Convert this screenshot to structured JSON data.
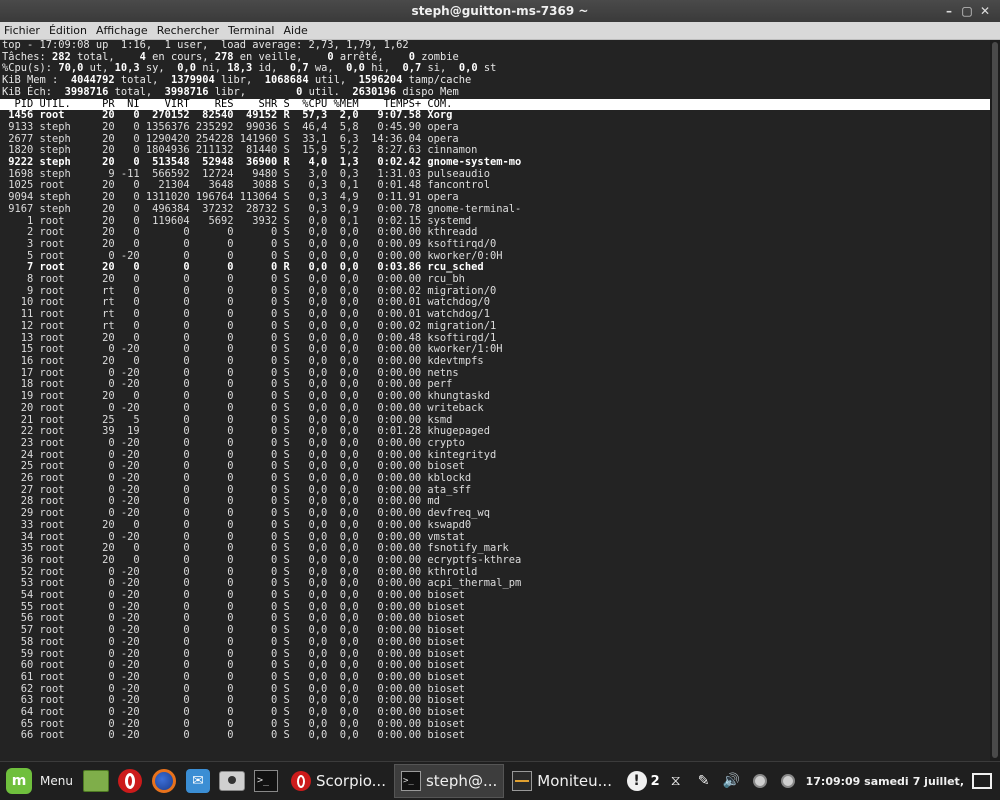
{
  "window": {
    "title": "steph@guitton-ms-7369 ~",
    "controls": [
      "–",
      "▢",
      "✕"
    ]
  },
  "menubar": [
    "Fichier",
    "Édition",
    "Affichage",
    "Rechercher",
    "Terminal",
    "Aide"
  ],
  "top_header": {
    "line1": "top - 17:09:08 up  1:16,  1 user,  load average: 2,73, 1,79, 1,62",
    "line2_parts": [
      "Tâches: ",
      "282",
      " total,    ",
      "4",
      " en cours, ",
      "278",
      " en veille,    ",
      "0",
      " arrêté,    ",
      "0",
      " zombie"
    ],
    "line3_parts": [
      "%Cpu(s): ",
      "70,0",
      " ut, ",
      "10,3",
      " sy,  ",
      "0,0",
      " ni, ",
      "18,3",
      " id,  ",
      "0,7",
      " wa,  ",
      "0,0",
      " hi,  ",
      "0,7",
      " si,  ",
      "0,0",
      " st"
    ],
    "line4_parts": [
      "KiB Mem :  ",
      "4044792",
      " total,  ",
      "1379904",
      " libr,  ",
      "1068684",
      " util,  ",
      "1596204",
      " tamp/cache"
    ],
    "line5_parts": [
      "KiB Éch:  ",
      "3998716",
      " total,  ",
      "3998716",
      " libr,        ",
      "0",
      " util.  ",
      "2630196",
      " dispo Mem"
    ]
  },
  "columns": [
    "PID",
    "UTIL.",
    "PR",
    "NI",
    "VIRT",
    "RES",
    "SHR",
    "S",
    "%CPU",
    "%MEM",
    "TEMPS+",
    "COM."
  ],
  "processes": [
    {
      "pid": "1456",
      "user": "root",
      "pr": "20",
      "ni": "0",
      "virt": "270152",
      "res": "82540",
      "shr": "49152",
      "s": "R",
      "cpu": "57,3",
      "mem": "2,0",
      "time": "9:07.58",
      "cmd": "Xorg",
      "bold": true
    },
    {
      "pid": "9133",
      "user": "steph",
      "pr": "20",
      "ni": "0",
      "virt": "1356376",
      "res": "235292",
      "shr": "99036",
      "s": "S",
      "cpu": "46,4",
      "mem": "5,8",
      "time": "0:45.90",
      "cmd": "opera",
      "bold": false
    },
    {
      "pid": "2677",
      "user": "steph",
      "pr": "20",
      "ni": "0",
      "virt": "1290420",
      "res": "254228",
      "shr": "141960",
      "s": "S",
      "cpu": "33,1",
      "mem": "6,3",
      "time": "14:36.04",
      "cmd": "opera",
      "bold": false
    },
    {
      "pid": "1820",
      "user": "steph",
      "pr": "20",
      "ni": "0",
      "virt": "1804936",
      "res": "211132",
      "shr": "81440",
      "s": "S",
      "cpu": "15,9",
      "mem": "5,2",
      "time": "8:27.63",
      "cmd": "cinnamon",
      "bold": false
    },
    {
      "pid": "9222",
      "user": "steph",
      "pr": "20",
      "ni": "0",
      "virt": "513548",
      "res": "52948",
      "shr": "36900",
      "s": "R",
      "cpu": "4,0",
      "mem": "1,3",
      "time": "0:02.42",
      "cmd": "gnome-system-mo",
      "bold": true
    },
    {
      "pid": "1698",
      "user": "steph",
      "pr": "9",
      "ni": "-11",
      "virt": "566592",
      "res": "12724",
      "shr": "9480",
      "s": "S",
      "cpu": "3,0",
      "mem": "0,3",
      "time": "1:31.03",
      "cmd": "pulseaudio",
      "bold": false
    },
    {
      "pid": "1025",
      "user": "root",
      "pr": "20",
      "ni": "0",
      "virt": "21304",
      "res": "3648",
      "shr": "3088",
      "s": "S",
      "cpu": "0,3",
      "mem": "0,1",
      "time": "0:01.48",
      "cmd": "fancontrol",
      "bold": false
    },
    {
      "pid": "9094",
      "user": "steph",
      "pr": "20",
      "ni": "0",
      "virt": "1311020",
      "res": "196764",
      "shr": "113064",
      "s": "S",
      "cpu": "0,3",
      "mem": "4,9",
      "time": "0:11.91",
      "cmd": "opera",
      "bold": false
    },
    {
      "pid": "9167",
      "user": "steph",
      "pr": "20",
      "ni": "0",
      "virt": "496384",
      "res": "37232",
      "shr": "28732",
      "s": "S",
      "cpu": "0,3",
      "mem": "0,9",
      "time": "0:00.78",
      "cmd": "gnome-terminal-",
      "bold": false
    },
    {
      "pid": "1",
      "user": "root",
      "pr": "20",
      "ni": "0",
      "virt": "119604",
      "res": "5692",
      "shr": "3932",
      "s": "S",
      "cpu": "0,0",
      "mem": "0,1",
      "time": "0:02.15",
      "cmd": "systemd",
      "bold": false
    },
    {
      "pid": "2",
      "user": "root",
      "pr": "20",
      "ni": "0",
      "virt": "0",
      "res": "0",
      "shr": "0",
      "s": "S",
      "cpu": "0,0",
      "mem": "0,0",
      "time": "0:00.00",
      "cmd": "kthreadd",
      "bold": false
    },
    {
      "pid": "3",
      "user": "root",
      "pr": "20",
      "ni": "0",
      "virt": "0",
      "res": "0",
      "shr": "0",
      "s": "S",
      "cpu": "0,0",
      "mem": "0,0",
      "time": "0:00.09",
      "cmd": "ksoftirqd/0",
      "bold": false
    },
    {
      "pid": "5",
      "user": "root",
      "pr": "0",
      "ni": "-20",
      "virt": "0",
      "res": "0",
      "shr": "0",
      "s": "S",
      "cpu": "0,0",
      "mem": "0,0",
      "time": "0:00.00",
      "cmd": "kworker/0:0H",
      "bold": false
    },
    {
      "pid": "7",
      "user": "root",
      "pr": "20",
      "ni": "0",
      "virt": "0",
      "res": "0",
      "shr": "0",
      "s": "R",
      "cpu": "0,0",
      "mem": "0,0",
      "time": "0:03.86",
      "cmd": "rcu_sched",
      "bold": true
    },
    {
      "pid": "8",
      "user": "root",
      "pr": "20",
      "ni": "0",
      "virt": "0",
      "res": "0",
      "shr": "0",
      "s": "S",
      "cpu": "0,0",
      "mem": "0,0",
      "time": "0:00.00",
      "cmd": "rcu_bh",
      "bold": false
    },
    {
      "pid": "9",
      "user": "root",
      "pr": "rt",
      "ni": "0",
      "virt": "0",
      "res": "0",
      "shr": "0",
      "s": "S",
      "cpu": "0,0",
      "mem": "0,0",
      "time": "0:00.02",
      "cmd": "migration/0",
      "bold": false
    },
    {
      "pid": "10",
      "user": "root",
      "pr": "rt",
      "ni": "0",
      "virt": "0",
      "res": "0",
      "shr": "0",
      "s": "S",
      "cpu": "0,0",
      "mem": "0,0",
      "time": "0:00.01",
      "cmd": "watchdog/0",
      "bold": false
    },
    {
      "pid": "11",
      "user": "root",
      "pr": "rt",
      "ni": "0",
      "virt": "0",
      "res": "0",
      "shr": "0",
      "s": "S",
      "cpu": "0,0",
      "mem": "0,0",
      "time": "0:00.01",
      "cmd": "watchdog/1",
      "bold": false
    },
    {
      "pid": "12",
      "user": "root",
      "pr": "rt",
      "ni": "0",
      "virt": "0",
      "res": "0",
      "shr": "0",
      "s": "S",
      "cpu": "0,0",
      "mem": "0,0",
      "time": "0:00.02",
      "cmd": "migration/1",
      "bold": false
    },
    {
      "pid": "13",
      "user": "root",
      "pr": "20",
      "ni": "0",
      "virt": "0",
      "res": "0",
      "shr": "0",
      "s": "S",
      "cpu": "0,0",
      "mem": "0,0",
      "time": "0:00.48",
      "cmd": "ksoftirqd/1",
      "bold": false
    },
    {
      "pid": "15",
      "user": "root",
      "pr": "0",
      "ni": "-20",
      "virt": "0",
      "res": "0",
      "shr": "0",
      "s": "S",
      "cpu": "0,0",
      "mem": "0,0",
      "time": "0:00.00",
      "cmd": "kworker/1:0H",
      "bold": false
    },
    {
      "pid": "16",
      "user": "root",
      "pr": "20",
      "ni": "0",
      "virt": "0",
      "res": "0",
      "shr": "0",
      "s": "S",
      "cpu": "0,0",
      "mem": "0,0",
      "time": "0:00.00",
      "cmd": "kdevtmpfs",
      "bold": false
    },
    {
      "pid": "17",
      "user": "root",
      "pr": "0",
      "ni": "-20",
      "virt": "0",
      "res": "0",
      "shr": "0",
      "s": "S",
      "cpu": "0,0",
      "mem": "0,0",
      "time": "0:00.00",
      "cmd": "netns",
      "bold": false
    },
    {
      "pid": "18",
      "user": "root",
      "pr": "0",
      "ni": "-20",
      "virt": "0",
      "res": "0",
      "shr": "0",
      "s": "S",
      "cpu": "0,0",
      "mem": "0,0",
      "time": "0:00.00",
      "cmd": "perf",
      "bold": false
    },
    {
      "pid": "19",
      "user": "root",
      "pr": "20",
      "ni": "0",
      "virt": "0",
      "res": "0",
      "shr": "0",
      "s": "S",
      "cpu": "0,0",
      "mem": "0,0",
      "time": "0:00.00",
      "cmd": "khungtaskd",
      "bold": false
    },
    {
      "pid": "20",
      "user": "root",
      "pr": "0",
      "ni": "-20",
      "virt": "0",
      "res": "0",
      "shr": "0",
      "s": "S",
      "cpu": "0,0",
      "mem": "0,0",
      "time": "0:00.00",
      "cmd": "writeback",
      "bold": false
    },
    {
      "pid": "21",
      "user": "root",
      "pr": "25",
      "ni": "5",
      "virt": "0",
      "res": "0",
      "shr": "0",
      "s": "S",
      "cpu": "0,0",
      "mem": "0,0",
      "time": "0:00.00",
      "cmd": "ksmd",
      "bold": false
    },
    {
      "pid": "22",
      "user": "root",
      "pr": "39",
      "ni": "19",
      "virt": "0",
      "res": "0",
      "shr": "0",
      "s": "S",
      "cpu": "0,0",
      "mem": "0,0",
      "time": "0:01.28",
      "cmd": "khugepaged",
      "bold": false
    },
    {
      "pid": "23",
      "user": "root",
      "pr": "0",
      "ni": "-20",
      "virt": "0",
      "res": "0",
      "shr": "0",
      "s": "S",
      "cpu": "0,0",
      "mem": "0,0",
      "time": "0:00.00",
      "cmd": "crypto",
      "bold": false
    },
    {
      "pid": "24",
      "user": "root",
      "pr": "0",
      "ni": "-20",
      "virt": "0",
      "res": "0",
      "shr": "0",
      "s": "S",
      "cpu": "0,0",
      "mem": "0,0",
      "time": "0:00.00",
      "cmd": "kintegrityd",
      "bold": false
    },
    {
      "pid": "25",
      "user": "root",
      "pr": "0",
      "ni": "-20",
      "virt": "0",
      "res": "0",
      "shr": "0",
      "s": "S",
      "cpu": "0,0",
      "mem": "0,0",
      "time": "0:00.00",
      "cmd": "bioset",
      "bold": false
    },
    {
      "pid": "26",
      "user": "root",
      "pr": "0",
      "ni": "-20",
      "virt": "0",
      "res": "0",
      "shr": "0",
      "s": "S",
      "cpu": "0,0",
      "mem": "0,0",
      "time": "0:00.00",
      "cmd": "kblockd",
      "bold": false
    },
    {
      "pid": "27",
      "user": "root",
      "pr": "0",
      "ni": "-20",
      "virt": "0",
      "res": "0",
      "shr": "0",
      "s": "S",
      "cpu": "0,0",
      "mem": "0,0",
      "time": "0:00.00",
      "cmd": "ata_sff",
      "bold": false
    },
    {
      "pid": "28",
      "user": "root",
      "pr": "0",
      "ni": "-20",
      "virt": "0",
      "res": "0",
      "shr": "0",
      "s": "S",
      "cpu": "0,0",
      "mem": "0,0",
      "time": "0:00.00",
      "cmd": "md",
      "bold": false
    },
    {
      "pid": "29",
      "user": "root",
      "pr": "0",
      "ni": "-20",
      "virt": "0",
      "res": "0",
      "shr": "0",
      "s": "S",
      "cpu": "0,0",
      "mem": "0,0",
      "time": "0:00.00",
      "cmd": "devfreq_wq",
      "bold": false
    },
    {
      "pid": "33",
      "user": "root",
      "pr": "20",
      "ni": "0",
      "virt": "0",
      "res": "0",
      "shr": "0",
      "s": "S",
      "cpu": "0,0",
      "mem": "0,0",
      "time": "0:00.00",
      "cmd": "kswapd0",
      "bold": false
    },
    {
      "pid": "34",
      "user": "root",
      "pr": "0",
      "ni": "-20",
      "virt": "0",
      "res": "0",
      "shr": "0",
      "s": "S",
      "cpu": "0,0",
      "mem": "0,0",
      "time": "0:00.00",
      "cmd": "vmstat",
      "bold": false
    },
    {
      "pid": "35",
      "user": "root",
      "pr": "20",
      "ni": "0",
      "virt": "0",
      "res": "0",
      "shr": "0",
      "s": "S",
      "cpu": "0,0",
      "mem": "0,0",
      "time": "0:00.00",
      "cmd": "fsnotify_mark",
      "bold": false
    },
    {
      "pid": "36",
      "user": "root",
      "pr": "20",
      "ni": "0",
      "virt": "0",
      "res": "0",
      "shr": "0",
      "s": "S",
      "cpu": "0,0",
      "mem": "0,0",
      "time": "0:00.00",
      "cmd": "ecryptfs-kthrea",
      "bold": false
    },
    {
      "pid": "52",
      "user": "root",
      "pr": "0",
      "ni": "-20",
      "virt": "0",
      "res": "0",
      "shr": "0",
      "s": "S",
      "cpu": "0,0",
      "mem": "0,0",
      "time": "0:00.00",
      "cmd": "kthrotld",
      "bold": false
    },
    {
      "pid": "53",
      "user": "root",
      "pr": "0",
      "ni": "-20",
      "virt": "0",
      "res": "0",
      "shr": "0",
      "s": "S",
      "cpu": "0,0",
      "mem": "0,0",
      "time": "0:00.00",
      "cmd": "acpi_thermal_pm",
      "bold": false
    },
    {
      "pid": "54",
      "user": "root",
      "pr": "0",
      "ni": "-20",
      "virt": "0",
      "res": "0",
      "shr": "0",
      "s": "S",
      "cpu": "0,0",
      "mem": "0,0",
      "time": "0:00.00",
      "cmd": "bioset",
      "bold": false
    },
    {
      "pid": "55",
      "user": "root",
      "pr": "0",
      "ni": "-20",
      "virt": "0",
      "res": "0",
      "shr": "0",
      "s": "S",
      "cpu": "0,0",
      "mem": "0,0",
      "time": "0:00.00",
      "cmd": "bioset",
      "bold": false
    },
    {
      "pid": "56",
      "user": "root",
      "pr": "0",
      "ni": "-20",
      "virt": "0",
      "res": "0",
      "shr": "0",
      "s": "S",
      "cpu": "0,0",
      "mem": "0,0",
      "time": "0:00.00",
      "cmd": "bioset",
      "bold": false
    },
    {
      "pid": "57",
      "user": "root",
      "pr": "0",
      "ni": "-20",
      "virt": "0",
      "res": "0",
      "shr": "0",
      "s": "S",
      "cpu": "0,0",
      "mem": "0,0",
      "time": "0:00.00",
      "cmd": "bioset",
      "bold": false
    },
    {
      "pid": "58",
      "user": "root",
      "pr": "0",
      "ni": "-20",
      "virt": "0",
      "res": "0",
      "shr": "0",
      "s": "S",
      "cpu": "0,0",
      "mem": "0,0",
      "time": "0:00.00",
      "cmd": "bioset",
      "bold": false
    },
    {
      "pid": "59",
      "user": "root",
      "pr": "0",
      "ni": "-20",
      "virt": "0",
      "res": "0",
      "shr": "0",
      "s": "S",
      "cpu": "0,0",
      "mem": "0,0",
      "time": "0:00.00",
      "cmd": "bioset",
      "bold": false
    },
    {
      "pid": "60",
      "user": "root",
      "pr": "0",
      "ni": "-20",
      "virt": "0",
      "res": "0",
      "shr": "0",
      "s": "S",
      "cpu": "0,0",
      "mem": "0,0",
      "time": "0:00.00",
      "cmd": "bioset",
      "bold": false
    },
    {
      "pid": "61",
      "user": "root",
      "pr": "0",
      "ni": "-20",
      "virt": "0",
      "res": "0",
      "shr": "0",
      "s": "S",
      "cpu": "0,0",
      "mem": "0,0",
      "time": "0:00.00",
      "cmd": "bioset",
      "bold": false
    },
    {
      "pid": "62",
      "user": "root",
      "pr": "0",
      "ni": "-20",
      "virt": "0",
      "res": "0",
      "shr": "0",
      "s": "S",
      "cpu": "0,0",
      "mem": "0,0",
      "time": "0:00.00",
      "cmd": "bioset",
      "bold": false
    },
    {
      "pid": "63",
      "user": "root",
      "pr": "0",
      "ni": "-20",
      "virt": "0",
      "res": "0",
      "shr": "0",
      "s": "S",
      "cpu": "0,0",
      "mem": "0,0",
      "time": "0:00.00",
      "cmd": "bioset",
      "bold": false
    },
    {
      "pid": "64",
      "user": "root",
      "pr": "0",
      "ni": "-20",
      "virt": "0",
      "res": "0",
      "shr": "0",
      "s": "S",
      "cpu": "0,0",
      "mem": "0,0",
      "time": "0:00.00",
      "cmd": "bioset",
      "bold": false
    },
    {
      "pid": "65",
      "user": "root",
      "pr": "0",
      "ni": "-20",
      "virt": "0",
      "res": "0",
      "shr": "0",
      "s": "S",
      "cpu": "0,0",
      "mem": "0,0",
      "time": "0:00.00",
      "cmd": "bioset",
      "bold": false
    },
    {
      "pid": "66",
      "user": "root",
      "pr": "0",
      "ni": "-20",
      "virt": "0",
      "res": "0",
      "shr": "0",
      "s": "S",
      "cpu": "0,0",
      "mem": "0,0",
      "time": "0:00.00",
      "cmd": "bioset",
      "bold": false
    }
  ],
  "taskbar": {
    "menu_label": "Menu",
    "tasks": [
      {
        "label": "Scorpio...",
        "icon": "opera-icon",
        "active": false
      },
      {
        "label": "steph@...",
        "icon": "terminal-icon",
        "active": true
      },
      {
        "label": "Moniteu...",
        "icon": "system-monitor-icon",
        "active": false
      }
    ],
    "notification_count": "2",
    "clock": "17:09:09 samedi",
    "date": "7 juillet,"
  },
  "colors": {
    "terminal_bg": "#232323",
    "header_row_bg": "#ffffff",
    "mint_green": "#6fbf3d",
    "opera_red": "#cc1b1b"
  }
}
